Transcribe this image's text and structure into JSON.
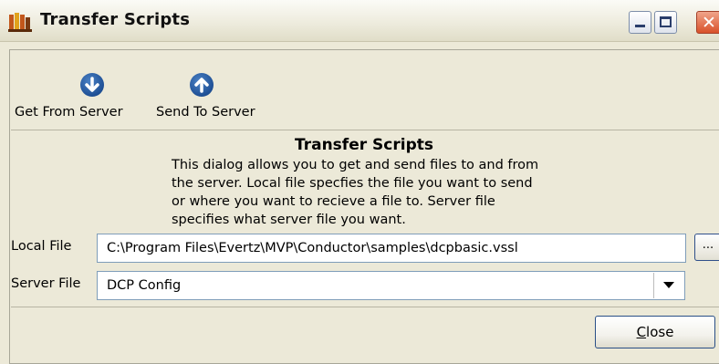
{
  "window": {
    "title": "Transfer Scripts",
    "icon": "transfer-scripts-app-icon",
    "controls": [
      "minimize",
      "maximize",
      "close"
    ]
  },
  "toolbar": {
    "get_from_server": {
      "label": "Get From Server",
      "icon": "arrow-down-circle-icon"
    },
    "send_to_server": {
      "label": "Send To Server",
      "icon": "arrow-up-circle-icon"
    }
  },
  "description": {
    "title": "Transfer Scripts",
    "lines": [
      "This dialog allows you to get and send files to and from",
      "the server.  Local file specfies the file you want to send",
      "or where you want to recieve a file to.  Server file",
      "specifies what server file you want."
    ]
  },
  "form": {
    "local_file": {
      "label": "Local File",
      "value": "C:\\Program Files\\Evertz\\MVP\\Conductor\\samples\\dcpbasic.vssl",
      "browse_label": "..."
    },
    "server_file": {
      "label": "Server File",
      "value": "DCP Config"
    }
  },
  "footer": {
    "close_label": "Close",
    "close_mnemonic": "C",
    "close_rest": "lose"
  },
  "colors": {
    "dialog_bg": "#ece9d8",
    "toolbar_icon": "#1e4f95",
    "close_window_button": "#d8512a",
    "field_border": "#7f9db9"
  }
}
